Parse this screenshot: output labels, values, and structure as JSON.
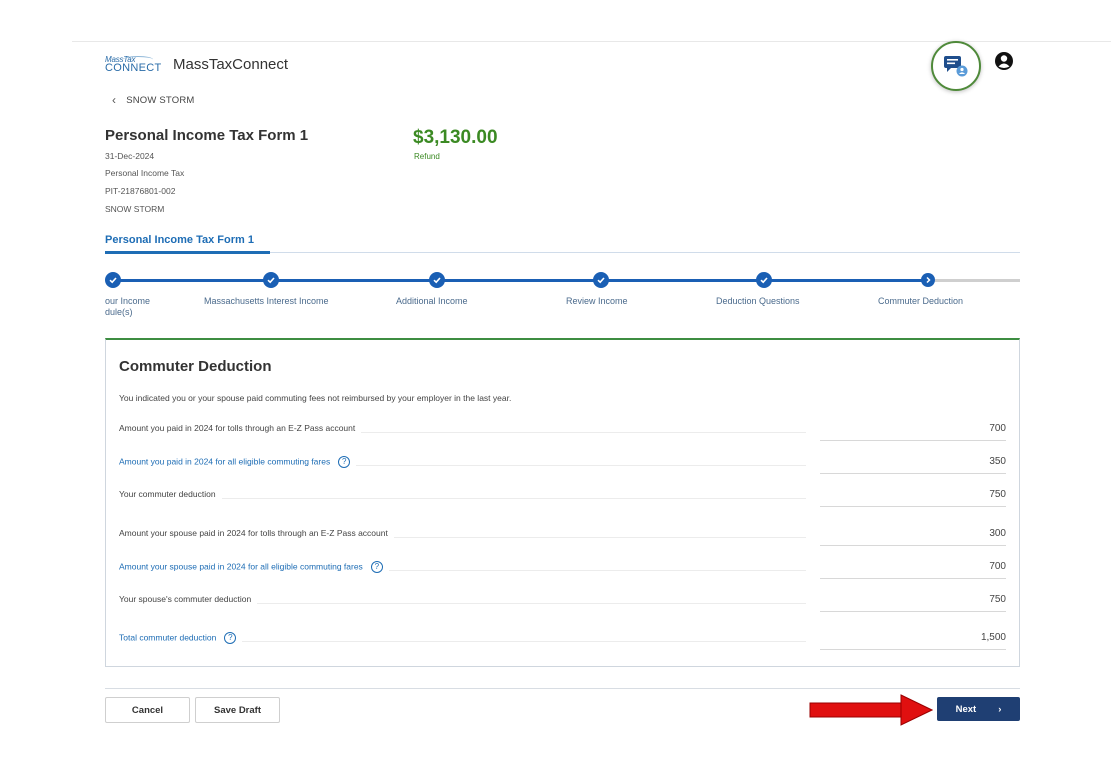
{
  "header": {
    "logo_top": "MassTax",
    "logo_bottom": "CONNECT",
    "app_name": "MassTaxConnect",
    "chat_icon": "chat-bubble-icon",
    "user_icon": "user-circle-icon"
  },
  "breadcrumb": {
    "back_label": "SNOW STORM"
  },
  "form": {
    "title": "Personal Income Tax Form 1",
    "date": "31-Dec-2024",
    "tax_type": "Personal Income Tax",
    "account_id": "PIT-21876801-002",
    "taxpayer": "SNOW STORM",
    "amount": "$3,130.00",
    "amount_label": "Refund",
    "tab_label": "Personal Income Tax Form 1"
  },
  "stepper": {
    "steps": [
      {
        "label": "our Income",
        "label2": "dule(s)",
        "status": "complete"
      },
      {
        "label": "Massachusetts Interest Income",
        "status": "complete"
      },
      {
        "label": "Additional Income",
        "status": "complete"
      },
      {
        "label": "Review Income",
        "status": "complete"
      },
      {
        "label": "Deduction Questions",
        "status": "complete"
      },
      {
        "label": "Commuter Deduction",
        "status": "current"
      }
    ]
  },
  "panel": {
    "title": "Commuter Deduction",
    "intro": "You indicated you or your spouse paid commuting fees not reimbursed by your employer in the last year.",
    "rows": [
      {
        "label": "Amount you paid in 2024 for tolls through an E-Z Pass account",
        "value": "700",
        "link": false,
        "help": false
      },
      {
        "label": "Amount you paid in 2024 for all eligible commuting fares",
        "value": "350",
        "link": true,
        "help": true
      },
      {
        "label": "Your commuter deduction",
        "value": "750",
        "link": false,
        "help": false
      },
      {
        "label": "Amount your spouse paid in 2024 for tolls through an E-Z Pass account",
        "value": "300",
        "link": false,
        "help": false
      },
      {
        "label": "Amount your spouse paid in 2024 for all eligible commuting fares",
        "value": "700",
        "link": true,
        "help": true
      },
      {
        "label": "Your spouse's commuter deduction",
        "value": "750",
        "link": false,
        "help": false
      },
      {
        "label": "Total commuter deduction",
        "value": "1,500",
        "link": true,
        "help": true
      }
    ]
  },
  "footer": {
    "cancel_label": "Cancel",
    "save_label": "Save Draft",
    "next_label": "Next",
    "next_chevron": "›"
  },
  "colors": {
    "accent": "#1e6db5",
    "refund": "#3b8a23",
    "next_button": "#1f3f73",
    "annotation_arrow": "#e01010"
  }
}
